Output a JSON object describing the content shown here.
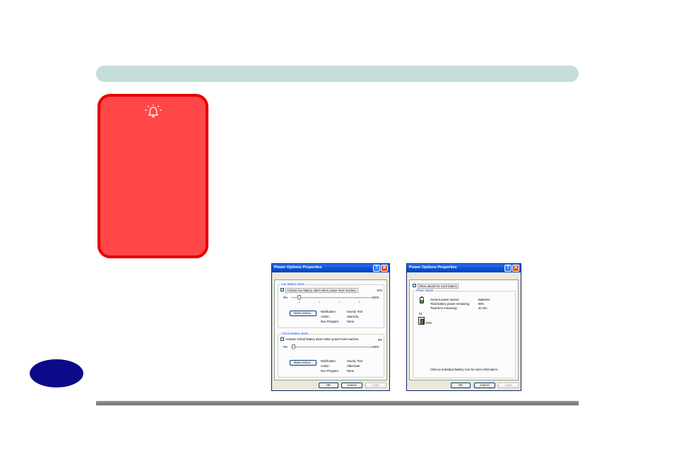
{
  "colors": {
    "header_bar": "#c5dcd8",
    "warning_fill": "#ff4747",
    "warning_border": "#e60000",
    "page_badge": "#0b0b8a",
    "xp_title_blue": "#0a4fd6",
    "xp_dialog_bg": "#ece9d8"
  },
  "warning_box": {
    "icon": "alarm-bell-icon"
  },
  "dialog_alarms": {
    "title": "Power Options Properties",
    "help_glyph": "?",
    "close_glyph": "✕",
    "tabs": [
      "Power Schemes",
      "Alarms",
      "Power Meter",
      "Advanced",
      "Hibernate"
    ],
    "active_tab": "Alarms",
    "low": {
      "group_title": "Low battery alarm",
      "checkbox_label": "Activate low battery alarm when power level reaches:",
      "checked": true,
      "value": "10%",
      "min_label": "0%",
      "max_label": "100%",
      "level": 0.1,
      "alarm_button": "Alarm Action...",
      "notification_label": "Notification:",
      "notification_value": "Sound, Text",
      "action_label": "Action:",
      "action_value": "Stand by",
      "run_label": "Run Program:",
      "run_value": "None"
    },
    "critical": {
      "group_title": "Critical battery alarm",
      "checkbox_label": "Activate critical battery alarm when power level reaches:",
      "checked": true,
      "value": "3%",
      "min_label": "0%",
      "max_label": "100%",
      "level": 0.03,
      "alarm_button": "Alarm Action...",
      "notification_label": "Notification:",
      "notification_value": "Sound, Text",
      "action_label": "Action:",
      "action_value": "Hibernate",
      "run_label": "Run Program:",
      "run_value": "None"
    },
    "buttons": {
      "ok": "OK",
      "cancel": "Cancel",
      "apply": "Apply"
    }
  },
  "dialog_meter": {
    "title": "Power Options Properties",
    "help_glyph": "?",
    "close_glyph": "✕",
    "tabs": [
      "Power Schemes",
      "Alarms",
      "Power Meter",
      "Advanced",
      "Hibernate"
    ],
    "active_tab": "Power Meter",
    "details_checkbox": "Show details for each battery",
    "details_checked": true,
    "group_title": "Power status",
    "source_label": "Current power source:",
    "source_value": "Batteries",
    "remaining_label": "Total battery power remaining:",
    "remaining_value": "96%",
    "time_label": "Total time remaining:",
    "time_value": "20 min",
    "battery_name": "#1",
    "battery_percent": "94%",
    "hint": "Click an individual battery icon for more information.",
    "buttons": {
      "ok": "OK",
      "cancel": "Cancel",
      "apply": "Apply"
    }
  }
}
